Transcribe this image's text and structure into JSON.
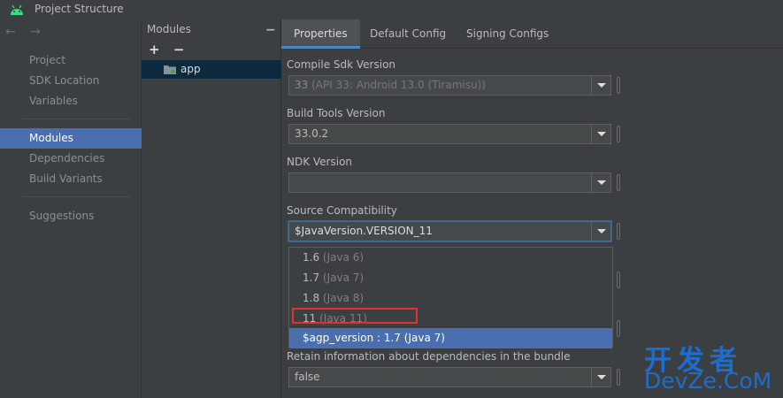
{
  "window": {
    "title": "Project Structure"
  },
  "nav": {
    "arrows": "← →",
    "items": [
      {
        "label": "Project"
      },
      {
        "label": "SDK Location"
      },
      {
        "label": "Variables"
      },
      {
        "label": "Modules"
      },
      {
        "label": "Dependencies"
      },
      {
        "label": "Build Variants"
      },
      {
        "label": "Suggestions"
      }
    ],
    "selected": "Modules"
  },
  "modules": {
    "header": "Modules",
    "collapse": "−",
    "add": "+",
    "remove": "−",
    "items": [
      {
        "label": "app"
      }
    ]
  },
  "tabs": [
    {
      "label": "Properties"
    },
    {
      "label": "Default Config"
    },
    {
      "label": "Signing Configs"
    }
  ],
  "active_tab": "Properties",
  "fields": {
    "compile_sdk": {
      "label": "Compile Sdk Version",
      "value": "33",
      "hint": "(API 33: Android 13.0 (Tiramisu))"
    },
    "build_tools": {
      "label": "Build Tools Version",
      "value": "33.0.2"
    },
    "ndk": {
      "label": "NDK Version",
      "value": ""
    },
    "source_compat": {
      "label": "Source Compatibility",
      "value": "$JavaVersion.VERSION_11"
    },
    "retain": {
      "label": "Retain information about dependencies in the bundle",
      "value": "false"
    }
  },
  "dropdown": {
    "options": [
      {
        "value": "1.6",
        "hint": "(Java 6)"
      },
      {
        "value": "1.7",
        "hint": "(Java 7)"
      },
      {
        "value": "1.8",
        "hint": "(Java 8)"
      },
      {
        "value": "11",
        "hint": "(Java 11)"
      },
      {
        "value": "$agp_version : 1.7",
        "hint": "(Java 7)"
      }
    ],
    "selected_index": 4,
    "highlighted_index": 3
  },
  "watermark": {
    "cn": "开发者",
    "en": "DevZe.CoM"
  },
  "colors": {
    "accent": "#4b6eaf",
    "highlight_box": "#e03030",
    "watermark": "#1c6dd0"
  }
}
